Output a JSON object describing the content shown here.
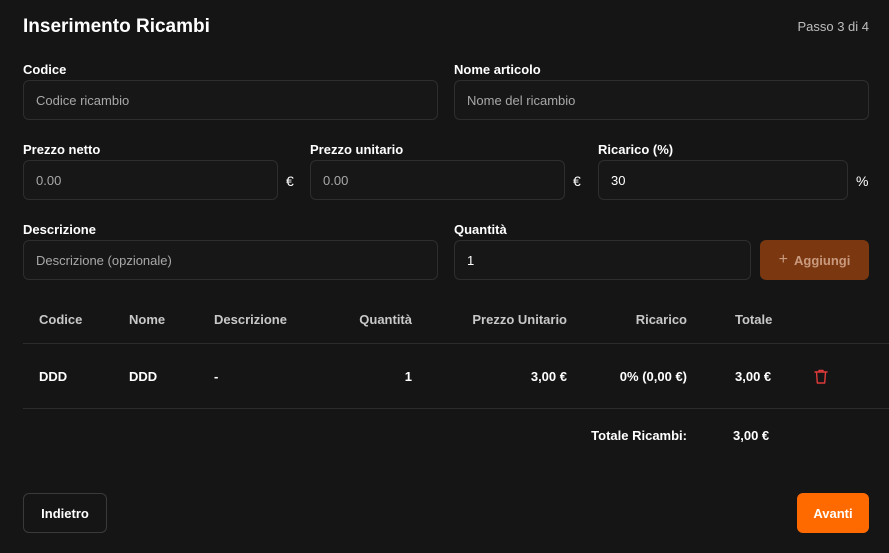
{
  "header": {
    "title": "Inserimento Ricambi",
    "step": "Passo 3 di 4"
  },
  "form": {
    "codice": {
      "label": "Codice",
      "placeholder": "Codice ricambio",
      "value": ""
    },
    "nome": {
      "label": "Nome articolo",
      "placeholder": "Nome del ricambio",
      "value": ""
    },
    "prezzo_netto": {
      "label": "Prezzo netto",
      "placeholder": "0.00",
      "suffix": "€"
    },
    "prezzo_unitario": {
      "label": "Prezzo unitario",
      "placeholder": "0.00",
      "suffix": "€"
    },
    "ricarico": {
      "label": "Ricarico (%)",
      "value": "30",
      "suffix": "%"
    },
    "descrizione": {
      "label": "Descrizione",
      "placeholder": "Descrizione (opzionale)"
    },
    "quantita": {
      "label": "Quantità",
      "value": "1"
    },
    "add_button": {
      "icon": "+",
      "label": "Aggiungi"
    }
  },
  "table": {
    "headers": [
      "Codice",
      "Nome",
      "Descrizione",
      "Quantità",
      "Prezzo Unitario",
      "Ricarico",
      "Totale"
    ],
    "rows": [
      {
        "codice": "DDD",
        "nome": "DDD",
        "descrizione": "-",
        "quantita": "1",
        "prezzo_unitario": "3,00 €",
        "ricarico": "0% (0,00 €)",
        "totale": "3,00 €"
      }
    ],
    "total_label": "Totale Ricambi:",
    "total_value": "3,00 €"
  },
  "footer": {
    "back_label": "Indietro",
    "next_label": "Avanti"
  },
  "colors": {
    "accent": "#ff6a00",
    "accent_disabled": "#7a3710",
    "delete": "#e03a3a",
    "background": "#151515"
  }
}
